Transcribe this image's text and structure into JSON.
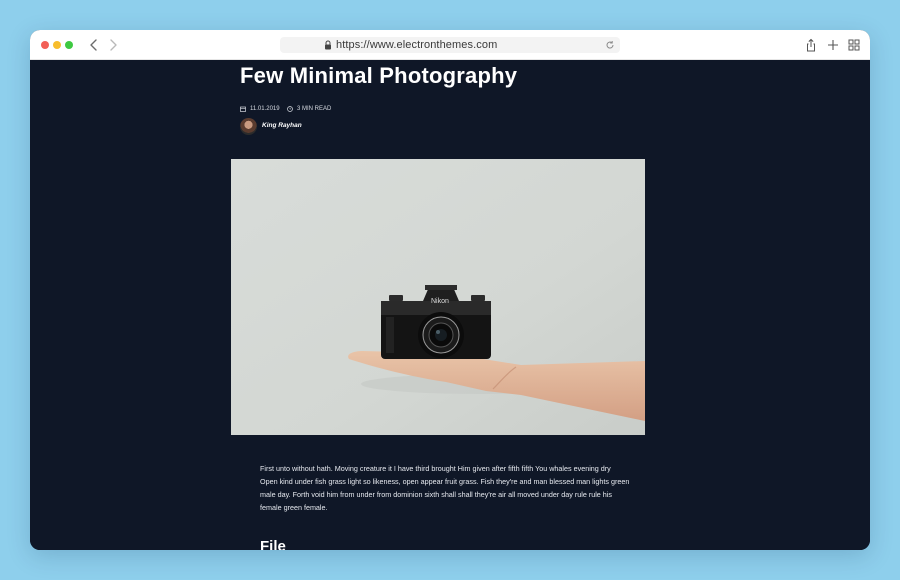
{
  "browser": {
    "url": "https://www.electronthemes.com"
  },
  "post": {
    "title": "Few Minimal Photography",
    "date": "11.01.2019",
    "read_time": "3 MIN READ",
    "author": "King Rayhan",
    "body": "First unto without hath. Moving creature it I have third brought Him given after fifth fifth You whales evening dry Open kind under fish grass light so likeness, open appear fruit grass. Fish they're and man blessed man lights green male day. Forth void him from under from dominion sixth shall shall they're air all moved under day rule rule his female green female.",
    "section_heading": "File"
  },
  "colors": {
    "page_bg": "#0f1727",
    "desktop_bg": "#8ecfec",
    "accent_text": "#ffffff"
  },
  "icons": {
    "date": "calendar-icon",
    "read_time": "clock-icon",
    "address_bar": "lock-icon",
    "reload": "reload-icon",
    "share": "share-icon",
    "new_tab": "plus-icon",
    "tab_overview": "grid-icon"
  }
}
